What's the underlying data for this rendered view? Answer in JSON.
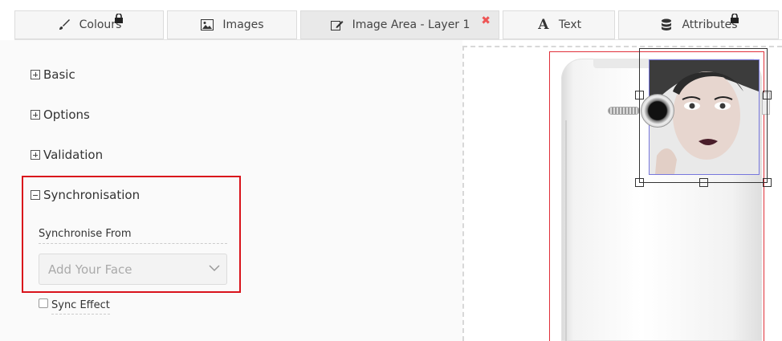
{
  "tabs": [
    {
      "label": "Colours",
      "icon": "brush-icon",
      "locked": true
    },
    {
      "label": "Images",
      "icon": "image-icon",
      "locked": false
    },
    {
      "label": "Image Area - Layer 1",
      "icon": "edit-icon",
      "active": true,
      "closable": true
    },
    {
      "label": "Text",
      "icon": "text-icon",
      "locked": false
    },
    {
      "label": "Attributes",
      "icon": "database-icon",
      "locked": true
    }
  ],
  "sections": {
    "basic": "Basic",
    "options": "Options",
    "validation": "Validation",
    "synchronisation": "Synchronisation"
  },
  "sync": {
    "from_label": "Synchronise From",
    "select_value": "Add Your Face",
    "effect_label": "Sync Effect",
    "effect_checked": false
  },
  "colors": {
    "highlight": "#d9131b",
    "close": "#e55555",
    "selection_frame": "#7777dd"
  }
}
